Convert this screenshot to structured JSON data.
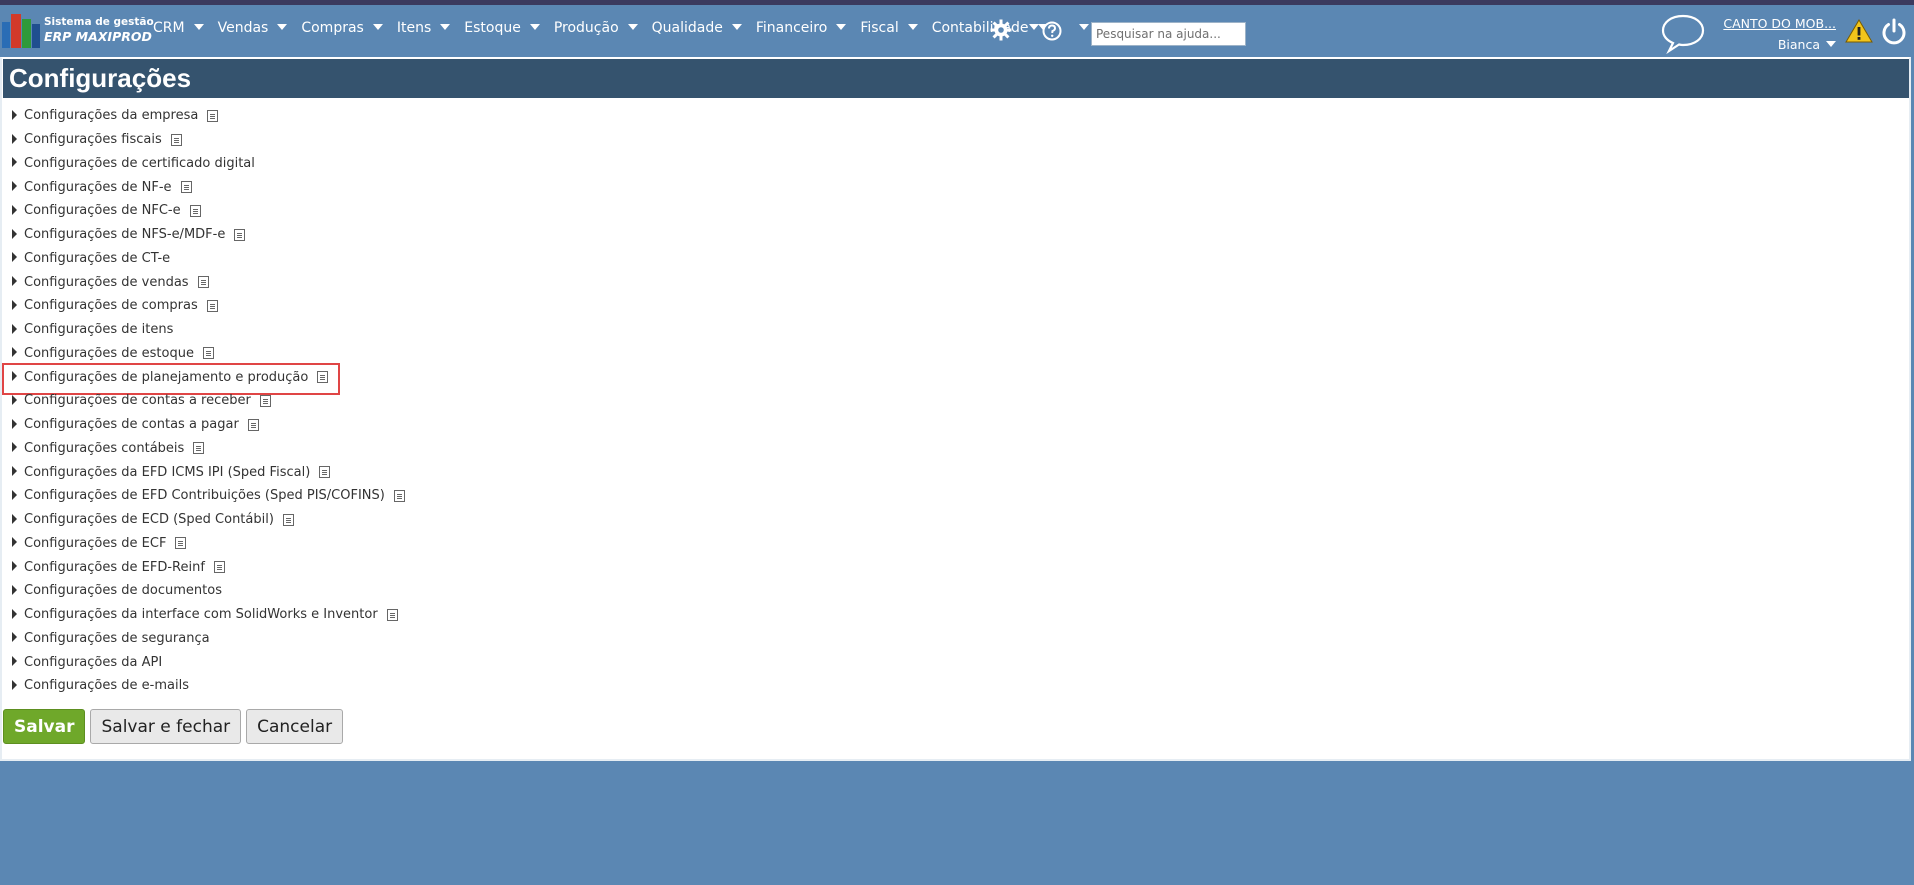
{
  "app": {
    "logo_line1": "Sistema de gestão",
    "logo_line2": "ERP MAXIPROD"
  },
  "menu": [
    {
      "label": "CRM",
      "icon": "caret-down-icon"
    },
    {
      "label": "Vendas",
      "icon": "caret-down-icon"
    },
    {
      "label": "Compras",
      "icon": "caret-down-icon"
    },
    {
      "label": "Itens",
      "icon": "caret-down-icon"
    },
    {
      "label": "Estoque",
      "icon": "caret-down-icon"
    },
    {
      "label": "Produção",
      "icon": "caret-down-icon"
    },
    {
      "label": "Qualidade",
      "icon": "caret-down-icon"
    },
    {
      "label": "Financeiro",
      "icon": "caret-down-icon"
    },
    {
      "label": "Fiscal",
      "icon": "caret-down-icon"
    },
    {
      "label": "Contabilidade",
      "icon": "caret-down-icon"
    }
  ],
  "search": {
    "placeholder": "Pesquisar na ajuda..."
  },
  "account": {
    "company": "CANTO DO MOB...",
    "user": "Bianca"
  },
  "page": {
    "title": "Configurações"
  },
  "config_items": [
    {
      "label": "Configurações da empresa",
      "has_doc_icon": true
    },
    {
      "label": "Configurações fiscais",
      "has_doc_icon": true
    },
    {
      "label": "Configurações de certificado digital",
      "has_doc_icon": false
    },
    {
      "label": "Configurações de NF-e",
      "has_doc_icon": true
    },
    {
      "label": "Configurações de NFC-e",
      "has_doc_icon": true
    },
    {
      "label": "Configurações de NFS-e/MDF-e",
      "has_doc_icon": true
    },
    {
      "label": "Configurações de CT-e",
      "has_doc_icon": false
    },
    {
      "label": "Configurações de vendas",
      "has_doc_icon": true
    },
    {
      "label": "Configurações de compras",
      "has_doc_icon": true
    },
    {
      "label": "Configurações de itens",
      "has_doc_icon": false
    },
    {
      "label": "Configurações de estoque",
      "has_doc_icon": true
    },
    {
      "label": "Configurações de planejamento e produção",
      "has_doc_icon": true,
      "highlighted": true
    },
    {
      "label": "Configurações de contas a receber",
      "has_doc_icon": true
    },
    {
      "label": "Configurações de contas a pagar",
      "has_doc_icon": true
    },
    {
      "label": "Configurações contábeis",
      "has_doc_icon": true
    },
    {
      "label": "Configurações da EFD ICMS IPI (Sped Fiscal)",
      "has_doc_icon": true
    },
    {
      "label": "Configurações de EFD Contribuições (Sped PIS/COFINS)",
      "has_doc_icon": true
    },
    {
      "label": "Configurações de ECD (Sped Contábil)",
      "has_doc_icon": true
    },
    {
      "label": "Configurações de ECF",
      "has_doc_icon": true
    },
    {
      "label": "Configurações de EFD-Reinf",
      "has_doc_icon": true
    },
    {
      "label": "Configurações de documentos",
      "has_doc_icon": false
    },
    {
      "label": "Configurações da interface com SolidWorks e Inventor",
      "has_doc_icon": true
    },
    {
      "label": "Configurações de segurança",
      "has_doc_icon": false
    },
    {
      "label": "Configurações da API",
      "has_doc_icon": false
    },
    {
      "label": "Configurações de e-mails",
      "has_doc_icon": false
    }
  ],
  "buttons": {
    "save": "Salvar",
    "save_close": "Salvar e fechar",
    "cancel": "Cancelar"
  },
  "colors": {
    "navbar": "#5b87b3",
    "title_bar": "#35536e",
    "save_button": "#6fa82a",
    "highlight": "#e04545"
  }
}
